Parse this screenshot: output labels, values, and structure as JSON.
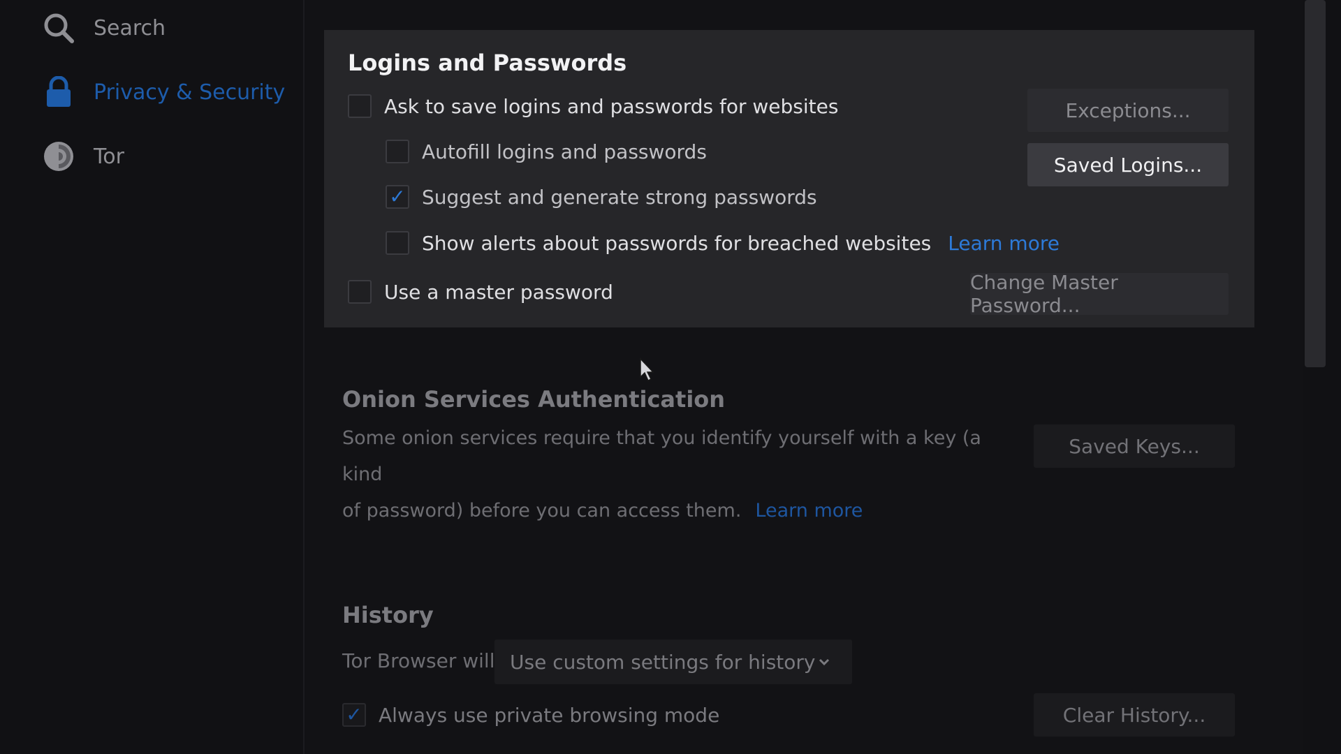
{
  "sidebar": {
    "items": [
      {
        "label": "Search",
        "icon": "search-icon"
      },
      {
        "label": "Privacy & Security",
        "icon": "lock-icon",
        "active": true
      },
      {
        "label": "Tor",
        "icon": "tor-onion-icon"
      }
    ]
  },
  "logins": {
    "title": "Logins and Passwords",
    "ask_save": {
      "label": "Ask to save logins and passwords for websites",
      "checked": false
    },
    "autofill": {
      "label": "Autofill logins and passwords",
      "checked": false
    },
    "suggest": {
      "label": "Suggest and generate strong passwords",
      "checked": true
    },
    "breach_alerts": {
      "label": "Show alerts about passwords for breached websites",
      "checked": false
    },
    "learn_more": "Learn more",
    "master_password": {
      "label": "Use a master password",
      "checked": false
    },
    "exceptions_button": "Exceptions...",
    "saved_logins_button": "Saved Logins...",
    "change_master_button": "Change Master Password..."
  },
  "onion": {
    "title": "Onion Services Authentication",
    "line1": "Some onion services require that you identify yourself with a key (a kind",
    "line2": "of password) before you can access them.",
    "learn_more": "Learn more",
    "saved_keys_button": "Saved Keys..."
  },
  "history": {
    "title": "History",
    "will_label": "Tor Browser will",
    "mode_select": "Use custom settings for history",
    "private_mode": {
      "label": "Always use private browsing mode",
      "checked": true
    },
    "clear_button": "Clear History..."
  },
  "colors": {
    "accent": "#2d7ad8",
    "card_bg": "#262629",
    "page_bg": "#121215"
  }
}
